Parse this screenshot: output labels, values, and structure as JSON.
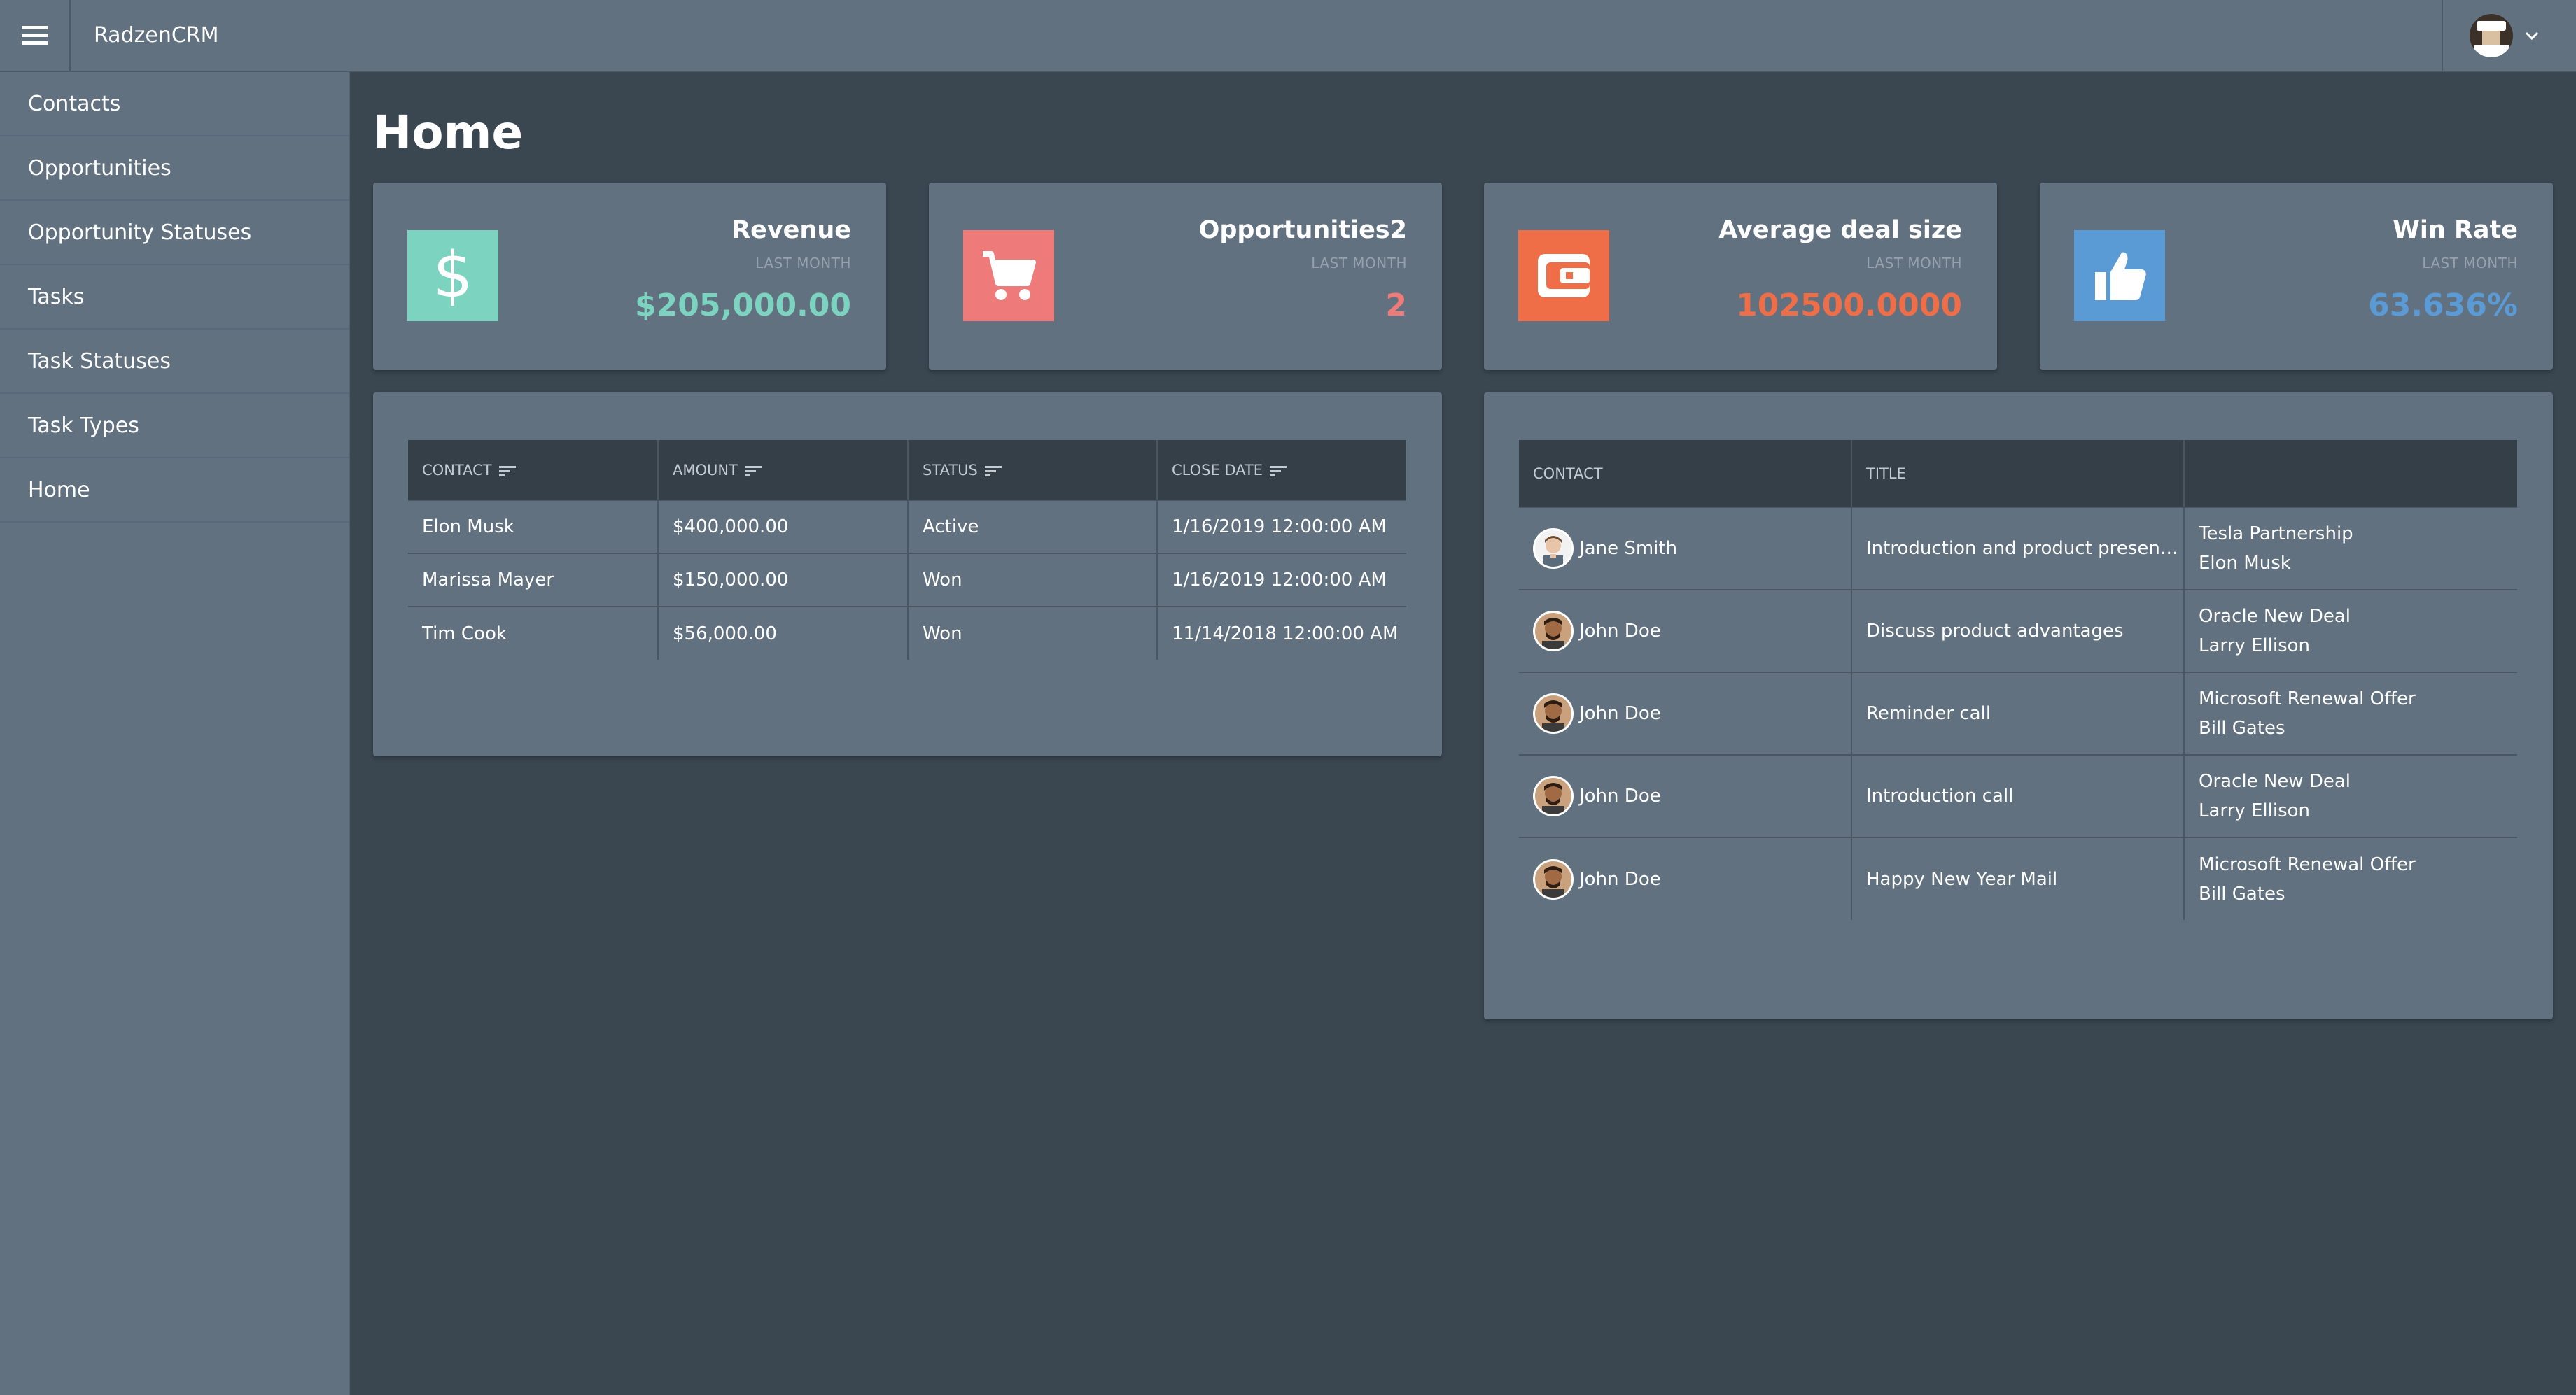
{
  "header": {
    "app_title": "RadzenCRM"
  },
  "sidebar": {
    "items": [
      {
        "label": "Contacts"
      },
      {
        "label": "Opportunities"
      },
      {
        "label": "Opportunity Statuses"
      },
      {
        "label": "Tasks"
      },
      {
        "label": "Task Statuses"
      },
      {
        "label": "Task Types"
      },
      {
        "label": "Home"
      }
    ]
  },
  "main": {
    "title": "Home",
    "stats": [
      {
        "title": "Revenue",
        "subtitle": "LAST MONTH",
        "value": "$205,000.00",
        "color": "#7cd4c0",
        "icon": "dollar-icon"
      },
      {
        "title": "Opportunities2",
        "subtitle": "LAST MONTH",
        "value": "2",
        "color": "#ee7a7a",
        "icon": "cart-icon"
      },
      {
        "title": "Average deal size",
        "subtitle": "LAST MONTH",
        "value": "102500.0000",
        "color": "#f06e47",
        "icon": "wallet-icon"
      },
      {
        "title": "Win Rate",
        "subtitle": "LAST MONTH",
        "value": "63.636%",
        "color": "#5b9bd5",
        "icon": "thumbs-up-icon"
      }
    ],
    "opportunities_table": {
      "columns": [
        "CONTACT",
        "AMOUNT",
        "STATUS",
        "CLOSE DATE"
      ],
      "rows": [
        [
          "Elon Musk",
          "$400,000.00",
          "Active",
          "1/16/2019 12:00:00 AM"
        ],
        [
          "Marissa Mayer",
          "$150,000.00",
          "Won",
          "1/16/2019 12:00:00 AM"
        ],
        [
          "Tim Cook",
          "$56,000.00",
          "Won",
          "11/14/2018 12:00:00 AM"
        ]
      ]
    },
    "tasks_table": {
      "columns": [
        "CONTACT",
        "TITLE",
        ""
      ],
      "rows": [
        {
          "contact": "Jane Smith",
          "title": "Introduction and product presenta...",
          "opportunity": "Tesla Partnership",
          "customer": "Elon Musk"
        },
        {
          "contact": "John Doe",
          "title": "Discuss product advantages",
          "opportunity": "Oracle New Deal",
          "customer": "Larry Ellison"
        },
        {
          "contact": "John Doe",
          "title": "Reminder call",
          "opportunity": "Microsoft Renewal Offer",
          "customer": "Bill Gates"
        },
        {
          "contact": "John Doe",
          "title": "Introduction call",
          "opportunity": "Oracle New Deal",
          "customer": "Larry Ellison"
        },
        {
          "contact": "John Doe",
          "title": "Happy New Year Mail",
          "opportunity": "Microsoft Renewal Offer",
          "customer": "Bill Gates"
        }
      ]
    }
  }
}
